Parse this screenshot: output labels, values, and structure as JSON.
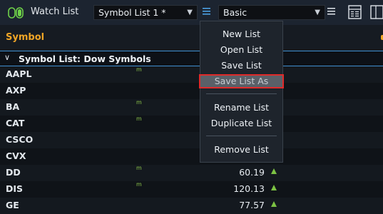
{
  "header": {
    "app_title": "Watch List",
    "symbol_list_select": "Symbol List 1 *",
    "view_select": "Basic"
  },
  "table": {
    "column_symbol": "Symbol",
    "group_label": "Symbol List: Dow Symbols",
    "rows": [
      {
        "symbol": "AAPL",
        "flag": "m",
        "price": "",
        "up": false
      },
      {
        "symbol": "AXP",
        "flag": "",
        "price": "",
        "up": false
      },
      {
        "symbol": "BA",
        "flag": "m",
        "price": "",
        "up": false
      },
      {
        "symbol": "CAT",
        "flag": "m",
        "price": "",
        "up": false
      },
      {
        "symbol": "CSCO",
        "flag": "",
        "price": "",
        "up": false
      },
      {
        "symbol": "CVX",
        "flag": "",
        "price": "",
        "up": false
      },
      {
        "symbol": "DD",
        "flag": "m",
        "price": "60.19",
        "up": true
      },
      {
        "symbol": "DIS",
        "flag": "m",
        "price": "120.13",
        "up": true
      },
      {
        "symbol": "GE",
        "flag": "",
        "price": "77.57",
        "up": true
      }
    ]
  },
  "menu": {
    "items": [
      "New List",
      "Open List",
      "Save List",
      "Save List As",
      "Rename List",
      "Duplicate List",
      "Remove List"
    ],
    "highlighted": "Save List As"
  },
  "colors": {
    "accent_orange": "#f0a526",
    "accent_blue": "#3f8fd0",
    "up_green": "#7cc243",
    "highlight_red": "#e02a2a"
  },
  "icons": [
    "app-toggle-icon",
    "chevron-down-icon",
    "hamburger-menu-icon",
    "grid-view-icon",
    "panel-view-icon"
  ]
}
